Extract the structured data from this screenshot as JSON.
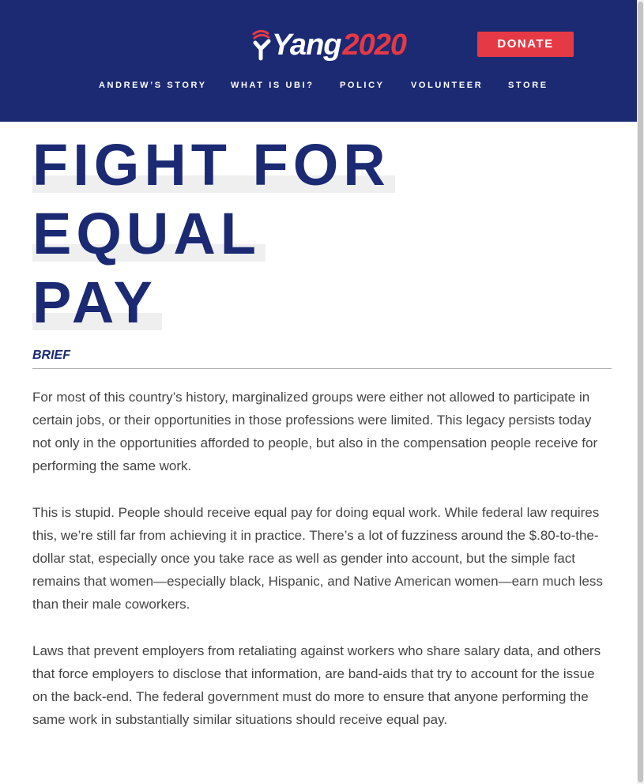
{
  "header": {
    "logo_name": "Yang",
    "logo_year": "2020",
    "donate_label": "DONATE",
    "nav": [
      {
        "label": "ANDREW’S STORY"
      },
      {
        "label": "WHAT IS UBI?"
      },
      {
        "label": "POLICY"
      },
      {
        "label": "VOLUNTEER"
      },
      {
        "label": "STORE"
      }
    ]
  },
  "article": {
    "title_lines": [
      "FIGHT FOR",
      "EQUAL",
      "PAY"
    ],
    "section_label": "BRIEF",
    "paragraphs": [
      "For most of this country’s history, marginalized groups were either not allowed to participate in certain jobs, or their opportunities in those professions were limited. This legacy persists today not only in the opportunities afforded to people, but also in the compensation people receive for performing the same work.",
      "This is stupid. People should receive equal pay for doing equal work. While federal law requires this, we’re still far from achieving it in practice. There’s a lot of fuzziness around the $.80-to-the-dollar stat, especially once you take race as well as gender into account, but the simple fact remains that women—especially black, Hispanic, and Native American women—earn much less than their male coworkers.",
      "Laws that prevent employers from retaliating against workers who share salary data, and others that force employers to disclose that information, are band-aids that try to account for the issue on the back-end. The federal government must do more to ensure that anyone performing the same work in substantially similar situations should receive equal pay."
    ]
  },
  "colors": {
    "brand_navy": "#1b2a73",
    "brand_red": "#e63946",
    "highlight_gray": "#efefef",
    "body_text": "#444444"
  },
  "icons": {
    "logo_mark": "flag-swoosh-icon"
  }
}
